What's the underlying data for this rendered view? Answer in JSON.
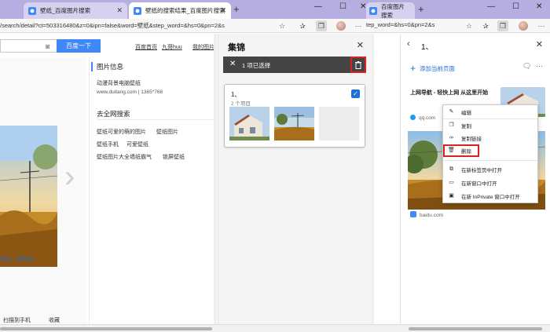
{
  "tabs": [
    {
      "label": "壁纸_百度图片搜索",
      "active": false
    },
    {
      "label": "壁纸的搜索结果_百度图片搜索",
      "active": true
    },
    {
      "label": "百度图片搜索",
      "active": false
    }
  ],
  "address": {
    "url_left": "/search/detail?ct=503316480&z=0&ipn=false&word=壁纸&step_word=&hs=0&pn=2&s",
    "url_right": "tep_word=&hs=0&pn=2&s"
  },
  "page": {
    "search_button": "百度一下",
    "top_links": [
      "百度首页",
      "九哥huu",
      "我的图片"
    ],
    "left_caption": "淘宝，超优品...",
    "left_bottom": [
      "扫描到手机",
      "收藏"
    ],
    "info_title": "图片信息",
    "info_name": "动漫背景电脑壁纸",
    "info_meta": "www.duitang.com  |  1365*768",
    "web_title": "去全网搜索",
    "tags": [
      "壁纸可爱的萌的图片",
      "壁纸图片",
      "壁纸手机",
      "可爱壁纸",
      "壁纸图片大全墙纸霸气",
      "锁屏壁纸"
    ]
  },
  "collections": {
    "title": "集锦",
    "selection_text": "1 项已选择",
    "card_title": "1、",
    "card_sub": "2 个项目"
  },
  "sidebar": {
    "title": "1、",
    "add_page": "添加当前页面",
    "item1_title": "上网导航 - 轻快上网 从这里开始",
    "item1_source": "qq.com",
    "item2_source": "baidu.com"
  },
  "context_menu": {
    "items": [
      "编辑",
      "复制",
      "复制链接",
      "删除",
      "在新标签页中打开",
      "在新窗口中打开",
      "在新 InPrivate 窗口中打开"
    ]
  },
  "colors": {
    "tabstrip": "#b6aee0",
    "accent_blue": "#3f88f8",
    "highlight_red": "#e02020"
  }
}
